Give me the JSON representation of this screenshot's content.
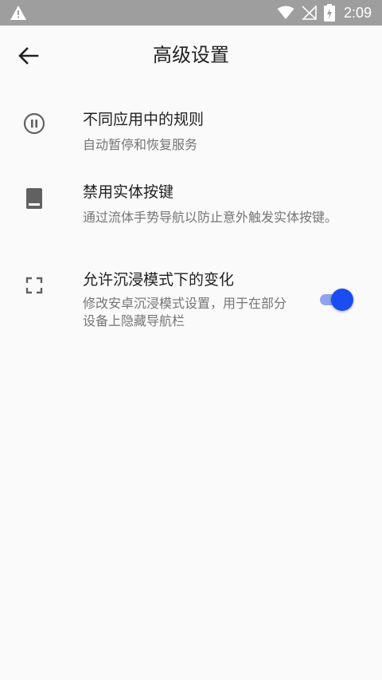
{
  "status_bar": {
    "time": "2:09",
    "icons": [
      "warning-icon",
      "wifi-icon",
      "no-signal-icon",
      "battery-charging-icon"
    ]
  },
  "app_bar": {
    "title": "高级设置",
    "back_icon": "arrow-back-icon"
  },
  "settings": [
    {
      "icon": "pause-circle-icon",
      "title": "不同应用中的规则",
      "description": "自动暂停和恢复服务"
    },
    {
      "icon": "book-icon",
      "title": "禁用实体按键",
      "description": "通过流体手势导航以防止意外触发实体按键。"
    },
    {
      "icon": "fullscreen-icon",
      "title": "允许沉浸模式下的变化",
      "description": "修改安卓沉浸模式设置，用于在部分设备上隐藏导航栏",
      "toggle_on": true
    }
  ],
  "colors": {
    "status_bar": "#9e9e9e",
    "accent": "#1a4df0",
    "accent_track": "#90a4ee",
    "title_text": "#212121",
    "secondary_text": "#757575",
    "icon": "#616161"
  }
}
